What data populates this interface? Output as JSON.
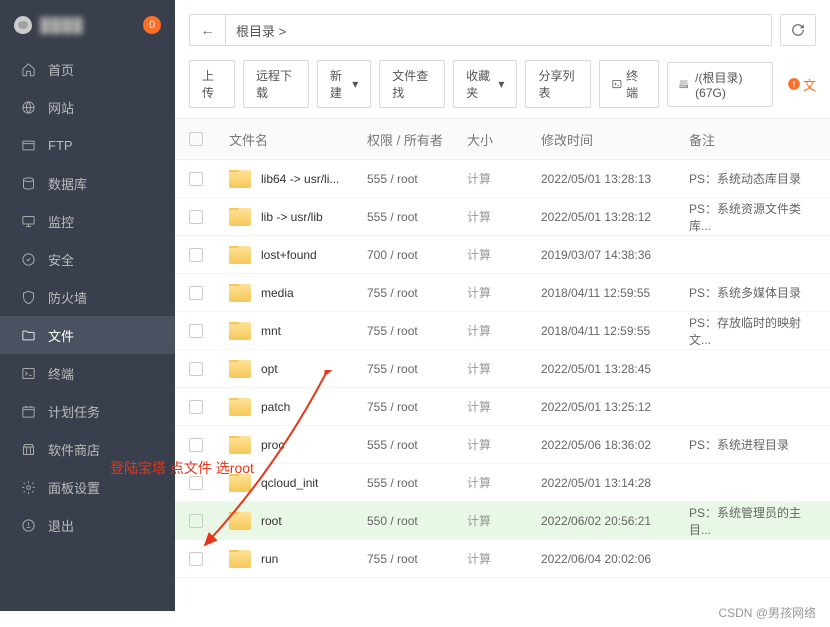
{
  "header": {
    "badge": "0"
  },
  "sidebar": {
    "items": [
      {
        "icon": "home",
        "label": "首页"
      },
      {
        "icon": "globe",
        "label": "网站"
      },
      {
        "icon": "ftp",
        "label": "FTP"
      },
      {
        "icon": "db",
        "label": "数据库"
      },
      {
        "icon": "monitor",
        "label": "监控"
      },
      {
        "icon": "security",
        "label": "安全"
      },
      {
        "icon": "shield",
        "label": "防火墙"
      },
      {
        "icon": "folder",
        "label": "文件",
        "active": true
      },
      {
        "icon": "terminal",
        "label": "终端"
      },
      {
        "icon": "schedule",
        "label": "计划任务"
      },
      {
        "icon": "store",
        "label": "软件商店"
      },
      {
        "icon": "settings",
        "label": "面板设置"
      },
      {
        "icon": "logout",
        "label": "退出"
      }
    ]
  },
  "path": {
    "root_label": "根目录",
    "sep": ">"
  },
  "toolbar": {
    "upload": "上传",
    "remote": "远程下载",
    "new": "新建",
    "find": "文件查找",
    "fav": "收藏夹",
    "share": "分享列表",
    "term": "终端",
    "disk": "/(根目录) (67G)",
    "warn": "文"
  },
  "columns": {
    "name": "文件名",
    "perm": "权限 / 所有者",
    "size": "大小",
    "mtime": "修改时间",
    "note": "备注"
  },
  "size_label": "计算",
  "rows": [
    {
      "name": "lib64 -> usr/li...",
      "perm": "555 / root",
      "mtime": "2022/05/01 13:28:13",
      "note": "PS：系统动态库目录"
    },
    {
      "name": "lib -> usr/lib",
      "perm": "555 / root",
      "mtime": "2022/05/01 13:28:12",
      "note": "PS：系统资源文件类库..."
    },
    {
      "name": "lost+found",
      "perm": "700 / root",
      "mtime": "2019/03/07 14:38:36",
      "note": ""
    },
    {
      "name": "media",
      "perm": "755 / root",
      "mtime": "2018/04/11 12:59:55",
      "note": "PS：系统多媒体目录"
    },
    {
      "name": "mnt",
      "perm": "755 / root",
      "mtime": "2018/04/11 12:59:55",
      "note": "PS：存放临时的映射文..."
    },
    {
      "name": "opt",
      "perm": "755 / root",
      "mtime": "2022/05/01 13:28:45",
      "note": ""
    },
    {
      "name": "patch",
      "perm": "755 / root",
      "mtime": "2022/05/01 13:25:12",
      "note": ""
    },
    {
      "name": "proc",
      "perm": "555 / root",
      "mtime": "2022/05/06 18:36:02",
      "note": "PS：系统进程目录"
    },
    {
      "name": "qcloud_init",
      "perm": "555 / root",
      "mtime": "2022/05/01 13:14:28",
      "note": ""
    },
    {
      "name": "root",
      "perm": "550 / root",
      "mtime": "2022/06/02 20:56:21",
      "note": "PS：系统管理员的主目...",
      "hl": true
    },
    {
      "name": "run",
      "perm": "755 / root",
      "mtime": "2022/06/04 20:02:06",
      "note": ""
    }
  ],
  "annotation": "登陆宝塔 点文件 选root",
  "watermark": "CSDN @男孩网络"
}
